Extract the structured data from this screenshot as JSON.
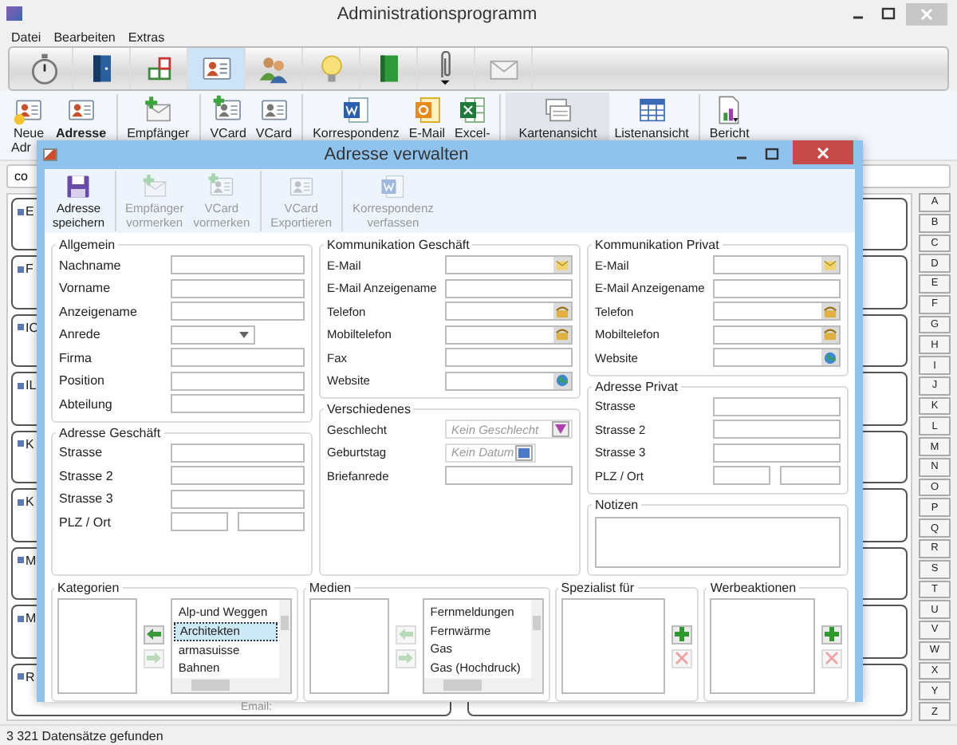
{
  "window": {
    "title": "Administrationsprogramm"
  },
  "menu": [
    "Datei",
    "Bearbeiten",
    "Extras"
  ],
  "main_toolbar": [
    {
      "kind": "stopwatch",
      "selected": false
    },
    {
      "kind": "door",
      "selected": false
    },
    {
      "kind": "squares",
      "selected": false
    },
    {
      "kind": "contact-card",
      "selected": true
    },
    {
      "kind": "people",
      "selected": false
    },
    {
      "kind": "bulb",
      "selected": false
    },
    {
      "kind": "book",
      "selected": false
    },
    {
      "kind": "paperclip",
      "selected": false
    },
    {
      "kind": "envelope",
      "selected": false
    }
  ],
  "ribbon_groups": [
    [
      {
        "kind": "new-card",
        "lines": [
          "Neue",
          "Adr"
        ],
        "emphasized": false,
        "selected": false
      },
      {
        "kind": "contact-card",
        "lines": [
          "Adresse"
        ],
        "emphasized": true,
        "selected": false
      }
    ],
    [
      {
        "kind": "add-mail",
        "lines": [
          "Empfänger"
        ],
        "emphasized": false,
        "selected": false
      }
    ],
    [
      {
        "kind": "add-card",
        "lines": [
          "VCard"
        ],
        "emphasized": false,
        "selected": false
      },
      {
        "kind": "vcard",
        "lines": [
          "VCard"
        ],
        "emphasized": false,
        "selected": false
      }
    ],
    [
      {
        "kind": "word-document",
        "lines": [
          "Korrespondenz"
        ],
        "emphasized": false,
        "selected": false
      },
      {
        "kind": "mail-document",
        "lines": [
          "E-Mail"
        ],
        "emphasized": false,
        "selected": false
      },
      {
        "kind": "spreadsheet",
        "lines": [
          "Excel-"
        ],
        "emphasized": false,
        "selected": false
      }
    ],
    [
      {
        "kind": "cards",
        "lines": [
          "Kartenansicht"
        ],
        "emphasized": false,
        "selected": true
      },
      {
        "kind": "table",
        "lines": [
          "Listenansicht"
        ],
        "emphasized": false,
        "selected": false
      }
    ],
    [
      {
        "kind": "report",
        "lines": [
          "Bericht"
        ],
        "emphasized": false,
        "selected": false
      }
    ]
  ],
  "search": {
    "value": "co"
  },
  "cards": [
    {
      "name": "E"
    },
    {
      "name": "F"
    },
    {
      "name": "IC"
    },
    {
      "name": "IL"
    },
    {
      "name": "K"
    },
    {
      "name": "K"
    },
    {
      "name": "M"
    },
    {
      "name": "M"
    },
    {
      "name": "R",
      "email_label": "Email:"
    }
  ],
  "alphabet": [
    "A",
    "B",
    "C",
    "D",
    "E",
    "F",
    "G",
    "H",
    "I",
    "J",
    "K",
    "L",
    "M",
    "N",
    "O",
    "P",
    "Q",
    "R",
    "S",
    "T",
    "U",
    "V",
    "W",
    "X",
    "Y",
    "Z"
  ],
  "status_bar": "3 321 Datensätze gefunden",
  "dialog": {
    "title": "Adresse verwalten",
    "toolbar_groups": [
      [
        {
          "kind": "save",
          "lines": [
            "Adresse",
            "speichern"
          ],
          "disabled": false
        }
      ],
      [
        {
          "kind": "add-mail",
          "lines": [
            "Empfänger",
            "vormerken"
          ],
          "disabled": true
        },
        {
          "kind": "add-card",
          "lines": [
            "VCard",
            "vormerken"
          ],
          "disabled": true
        }
      ],
      [
        {
          "kind": "vcard",
          "lines": [
            "VCard",
            "Exportieren"
          ],
          "disabled": true
        }
      ],
      [
        {
          "kind": "word-document",
          "lines": [
            "Korrespondenz",
            "verfassen"
          ],
          "disabled": true
        }
      ]
    ],
    "columns": [
      [
        {
          "title": "Allgemein",
          "kind": "form",
          "fields": [
            {
              "label": "Nachname",
              "kind": "text"
            },
            {
              "label": "Vorname",
              "kind": "text"
            },
            {
              "label": "Anzeigename",
              "kind": "text"
            },
            {
              "label": "Anrede",
              "kind": "combo"
            },
            {
              "label": "Firma",
              "kind": "text"
            },
            {
              "label": "Position",
              "kind": "text"
            },
            {
              "label": "Abteilung",
              "kind": "text"
            }
          ]
        },
        {
          "title": "Adresse Geschäft",
          "kind": "form",
          "fields": [
            {
              "label": "Strasse",
              "kind": "text"
            },
            {
              "label": "Strasse 2",
              "kind": "text"
            },
            {
              "label": "Strasse 3",
              "kind": "text"
            },
            {
              "label": "PLZ / Ort",
              "kind": "zip"
            }
          ]
        }
      ],
      [
        {
          "title": "Kommunikation Geschäft",
          "kind": "form",
          "fields": [
            {
              "label": "E-Mail",
              "kind": "mail"
            },
            {
              "label": "E-Mail Anzeigename",
              "kind": "text"
            },
            {
              "label": "Telefon",
              "kind": "phone"
            },
            {
              "label": "Mobiltelefon",
              "kind": "phone"
            },
            {
              "label": "Fax",
              "kind": "text"
            },
            {
              "label": "Website",
              "kind": "web"
            }
          ]
        },
        {
          "title": "Verschiedenes",
          "kind": "form",
          "fields": [
            {
              "label": "Geschlecht",
              "kind": "select",
              "placeholder": "Kein Geschlecht"
            },
            {
              "label": "Geburtstag",
              "kind": "date",
              "placeholder": "Kein Datum"
            },
            {
              "label": "Briefanrede",
              "kind": "text"
            }
          ]
        }
      ],
      [
        {
          "title": "Kommunikation Privat",
          "kind": "form",
          "fields": [
            {
              "label": "E-Mail",
              "kind": "mail"
            },
            {
              "label": "E-Mail Anzeigename",
              "kind": "text"
            },
            {
              "label": "Telefon",
              "kind": "phone"
            },
            {
              "label": "Mobiltelefon",
              "kind": "phone"
            },
            {
              "label": "Website",
              "kind": "web"
            }
          ]
        },
        {
          "title": "Adresse Privat",
          "kind": "form",
          "fields": [
            {
              "label": "Strasse",
              "kind": "text"
            },
            {
              "label": "Strasse 2",
              "kind": "text"
            },
            {
              "label": "Strasse 3",
              "kind": "text"
            },
            {
              "label": "PLZ / Ort",
              "kind": "zip"
            }
          ]
        },
        {
          "title": "Notizen",
          "kind": "notes"
        }
      ]
    ],
    "pickers": [
      {
        "title": "Kategorien",
        "kind": "transfer",
        "arrows": [
          {
            "kind": "left",
            "disabled": false
          },
          {
            "kind": "right",
            "disabled": true
          }
        ],
        "items": [
          {
            "text": "Alp-und Weggen",
            "selected": false
          },
          {
            "text": "Architekten",
            "selected": true
          },
          {
            "text": "armasuisse",
            "selected": false
          },
          {
            "text": "Bahnen",
            "selected": false
          }
        ]
      },
      {
        "title": "Medien",
        "kind": "transfer",
        "arrows": [
          {
            "kind": "left",
            "disabled": true
          },
          {
            "kind": "right",
            "disabled": true
          }
        ],
        "items": [
          {
            "text": "Fernmeldungen",
            "selected": false
          },
          {
            "text": "Fernwärme",
            "selected": false
          },
          {
            "text": "Gas",
            "selected": false
          },
          {
            "text": "Gas (Hochdruck)",
            "selected": false
          }
        ]
      },
      {
        "title": "Spezialist für",
        "kind": "editable",
        "add_disabled": false,
        "remove_disabled": true
      },
      {
        "title": "Werbeaktionen",
        "kind": "editable",
        "add_disabled": false,
        "remove_disabled": true
      }
    ]
  }
}
